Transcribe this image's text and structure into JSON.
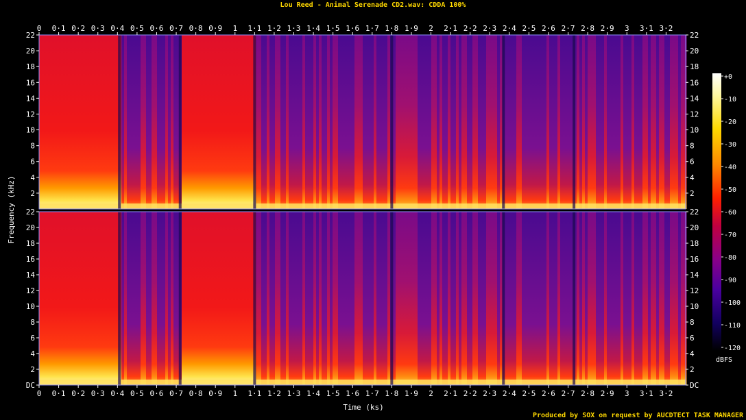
{
  "chart_data": {
    "type": "heatmap",
    "title": "Lou Reed - Animal Serenade CD2.wav: CDDA 100%",
    "xlabel": "Time (ks)",
    "ylabel": "Frequency (kHz)",
    "xlim": [
      0,
      3.3
    ],
    "ylim": [
      0,
      22
    ],
    "x_ticks": [
      "0",
      "0·1",
      "0·2",
      "0·3",
      "0·4",
      "0·5",
      "0·6",
      "0·7",
      "0·8",
      "0·9",
      "1",
      "1·1",
      "1·2",
      "1·3",
      "1·4",
      "1·5",
      "1·6",
      "1·7",
      "1·8",
      "1·9",
      "2",
      "2·1",
      "2·2",
      "2·3",
      "2·4",
      "2·5",
      "2·6",
      "2·7",
      "2·8",
      "2·9",
      "3",
      "3·1",
      "3·2"
    ],
    "y_ticks": [
      "DC",
      "2",
      "4",
      "6",
      "8",
      "10",
      "12",
      "14",
      "16",
      "18",
      "20",
      "22"
    ],
    "channels": 2,
    "colorbar": {
      "label": "dBFS",
      "ticks": [
        "+0",
        "-10",
        "-20",
        "-30",
        "-40",
        "-50",
        "-60",
        "-70",
        "-80",
        "-90",
        "-100",
        "-110",
        "-120"
      ],
      "range": [
        -120,
        0
      ]
    },
    "loud_segments_ks": [
      [
        0.0,
        0.41
      ],
      [
        0.72,
        1.1
      ]
    ],
    "track_boundaries_ks": [
      0.41,
      0.72,
      1.1,
      1.8,
      2.37,
      2.73
    ]
  },
  "footer": "Produced by SOX on request by AUCDTECT TASK MANAGER",
  "colors": {
    "title": "#ffd800",
    "footer": "#ffd800",
    "axis": "#ffffff",
    "frame": "#9090ff"
  }
}
